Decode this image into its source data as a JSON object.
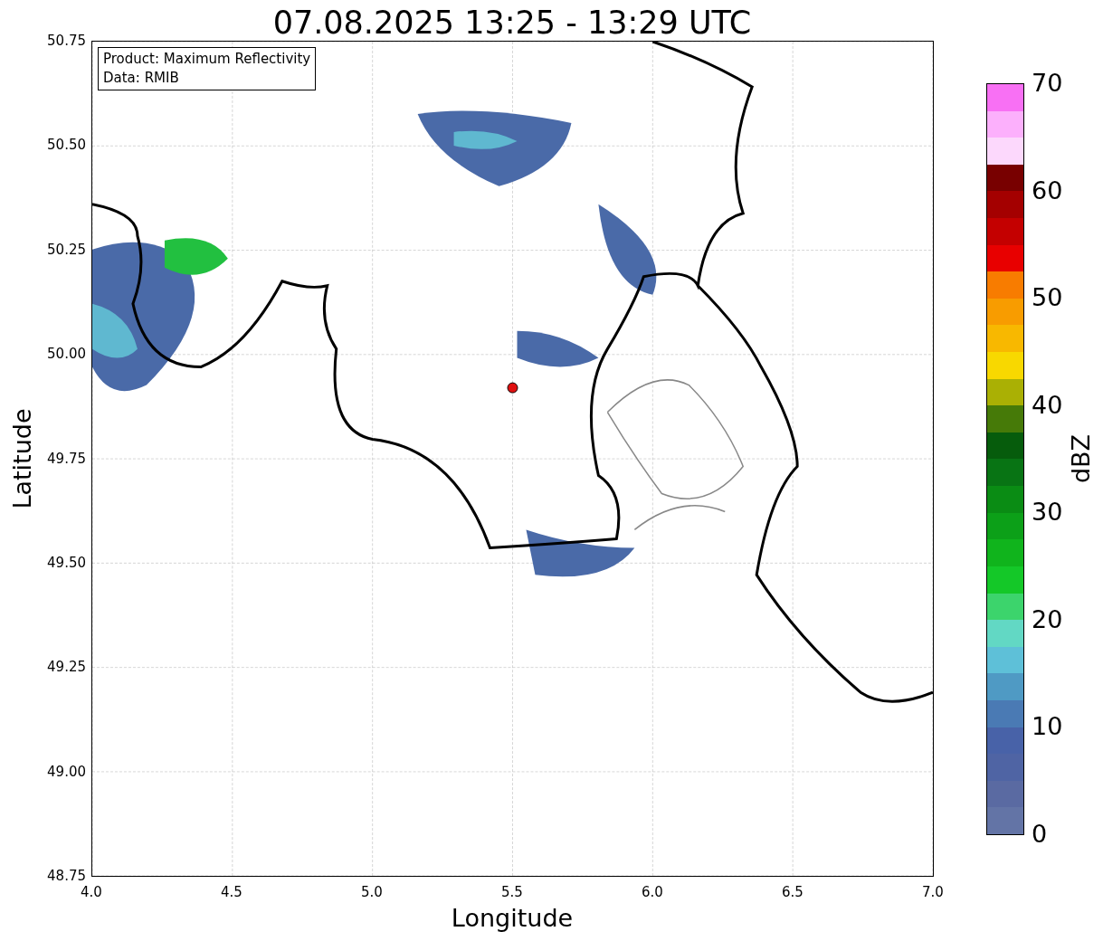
{
  "title": "07.08.2025 13:25 - 13:29 UTC",
  "legend": {
    "lines": [
      "Product: Maximum Reflectivity",
      "Data: RMIB"
    ]
  },
  "axes": {
    "xlabel": "Longitude",
    "ylabel": "Latitude",
    "xticks": [
      "4.0",
      "4.5",
      "5.0",
      "5.5",
      "6.0",
      "6.5",
      "7.0"
    ],
    "yticks": [
      "50.75",
      "50.50",
      "50.25",
      "50.00",
      "49.75",
      "49.50",
      "49.25",
      "49.00",
      "48.75"
    ]
  },
  "colorbar": {
    "label": "dBZ",
    "ticks": [
      "70",
      "60",
      "50",
      "40",
      "30",
      "20",
      "10",
      "0"
    ]
  }
}
